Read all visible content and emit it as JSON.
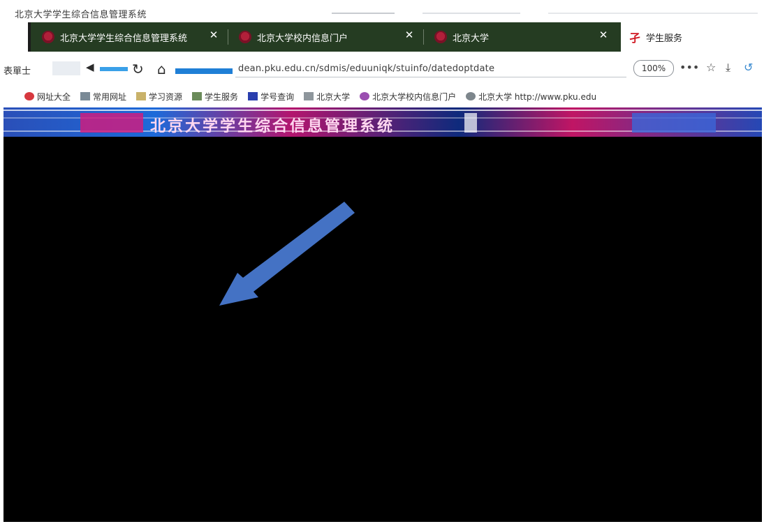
{
  "window": {
    "title": "北京大学学生综合信息管理系统"
  },
  "tabs": [
    {
      "label": "北京大学学生综合信息管理系统",
      "close": "✕"
    },
    {
      "label": "北京大学校内信息门户",
      "close": "✕"
    },
    {
      "label": "北京大学",
      "close": "✕"
    }
  ],
  "active_tab": {
    "icon_glyph": "孑",
    "label": "学生服务"
  },
  "toolbar": {
    "left_text": "表單士",
    "back_glyph": "◀",
    "reload_glyph": "↻",
    "home_glyph": "⌂",
    "url": "dean.pku.edu.cn/sdmis/eduuniqk/stuinfo/datedoptdate",
    "zoom": "100%",
    "more_glyph": "•••",
    "star_glyph": "☆",
    "download_glyph": "⤓"
  },
  "bookmarks": [
    {
      "label": "网址大全"
    },
    {
      "label": "常用网址"
    },
    {
      "label": "学习资源"
    },
    {
      "label": "学生服务"
    },
    {
      "label": "学号查询"
    },
    {
      "label": "北京大学"
    },
    {
      "label": "北京大学校内信息门户"
    },
    {
      "label": "北京大学 http://www.pku.edu"
    }
  ],
  "banner": {
    "text": "北京大学学生综合信息管理系统"
  },
  "colors": {
    "tab_strip_bg": "#253c22",
    "arrow_fill": "#4472c4",
    "content_bg": "#000000",
    "pku_red": "#b1203a"
  },
  "icons": {
    "tab_icon": "pku-crest-icon",
    "active_tab_icon": "student-service-icon",
    "arrow": "arrow-pointing-down-left"
  }
}
